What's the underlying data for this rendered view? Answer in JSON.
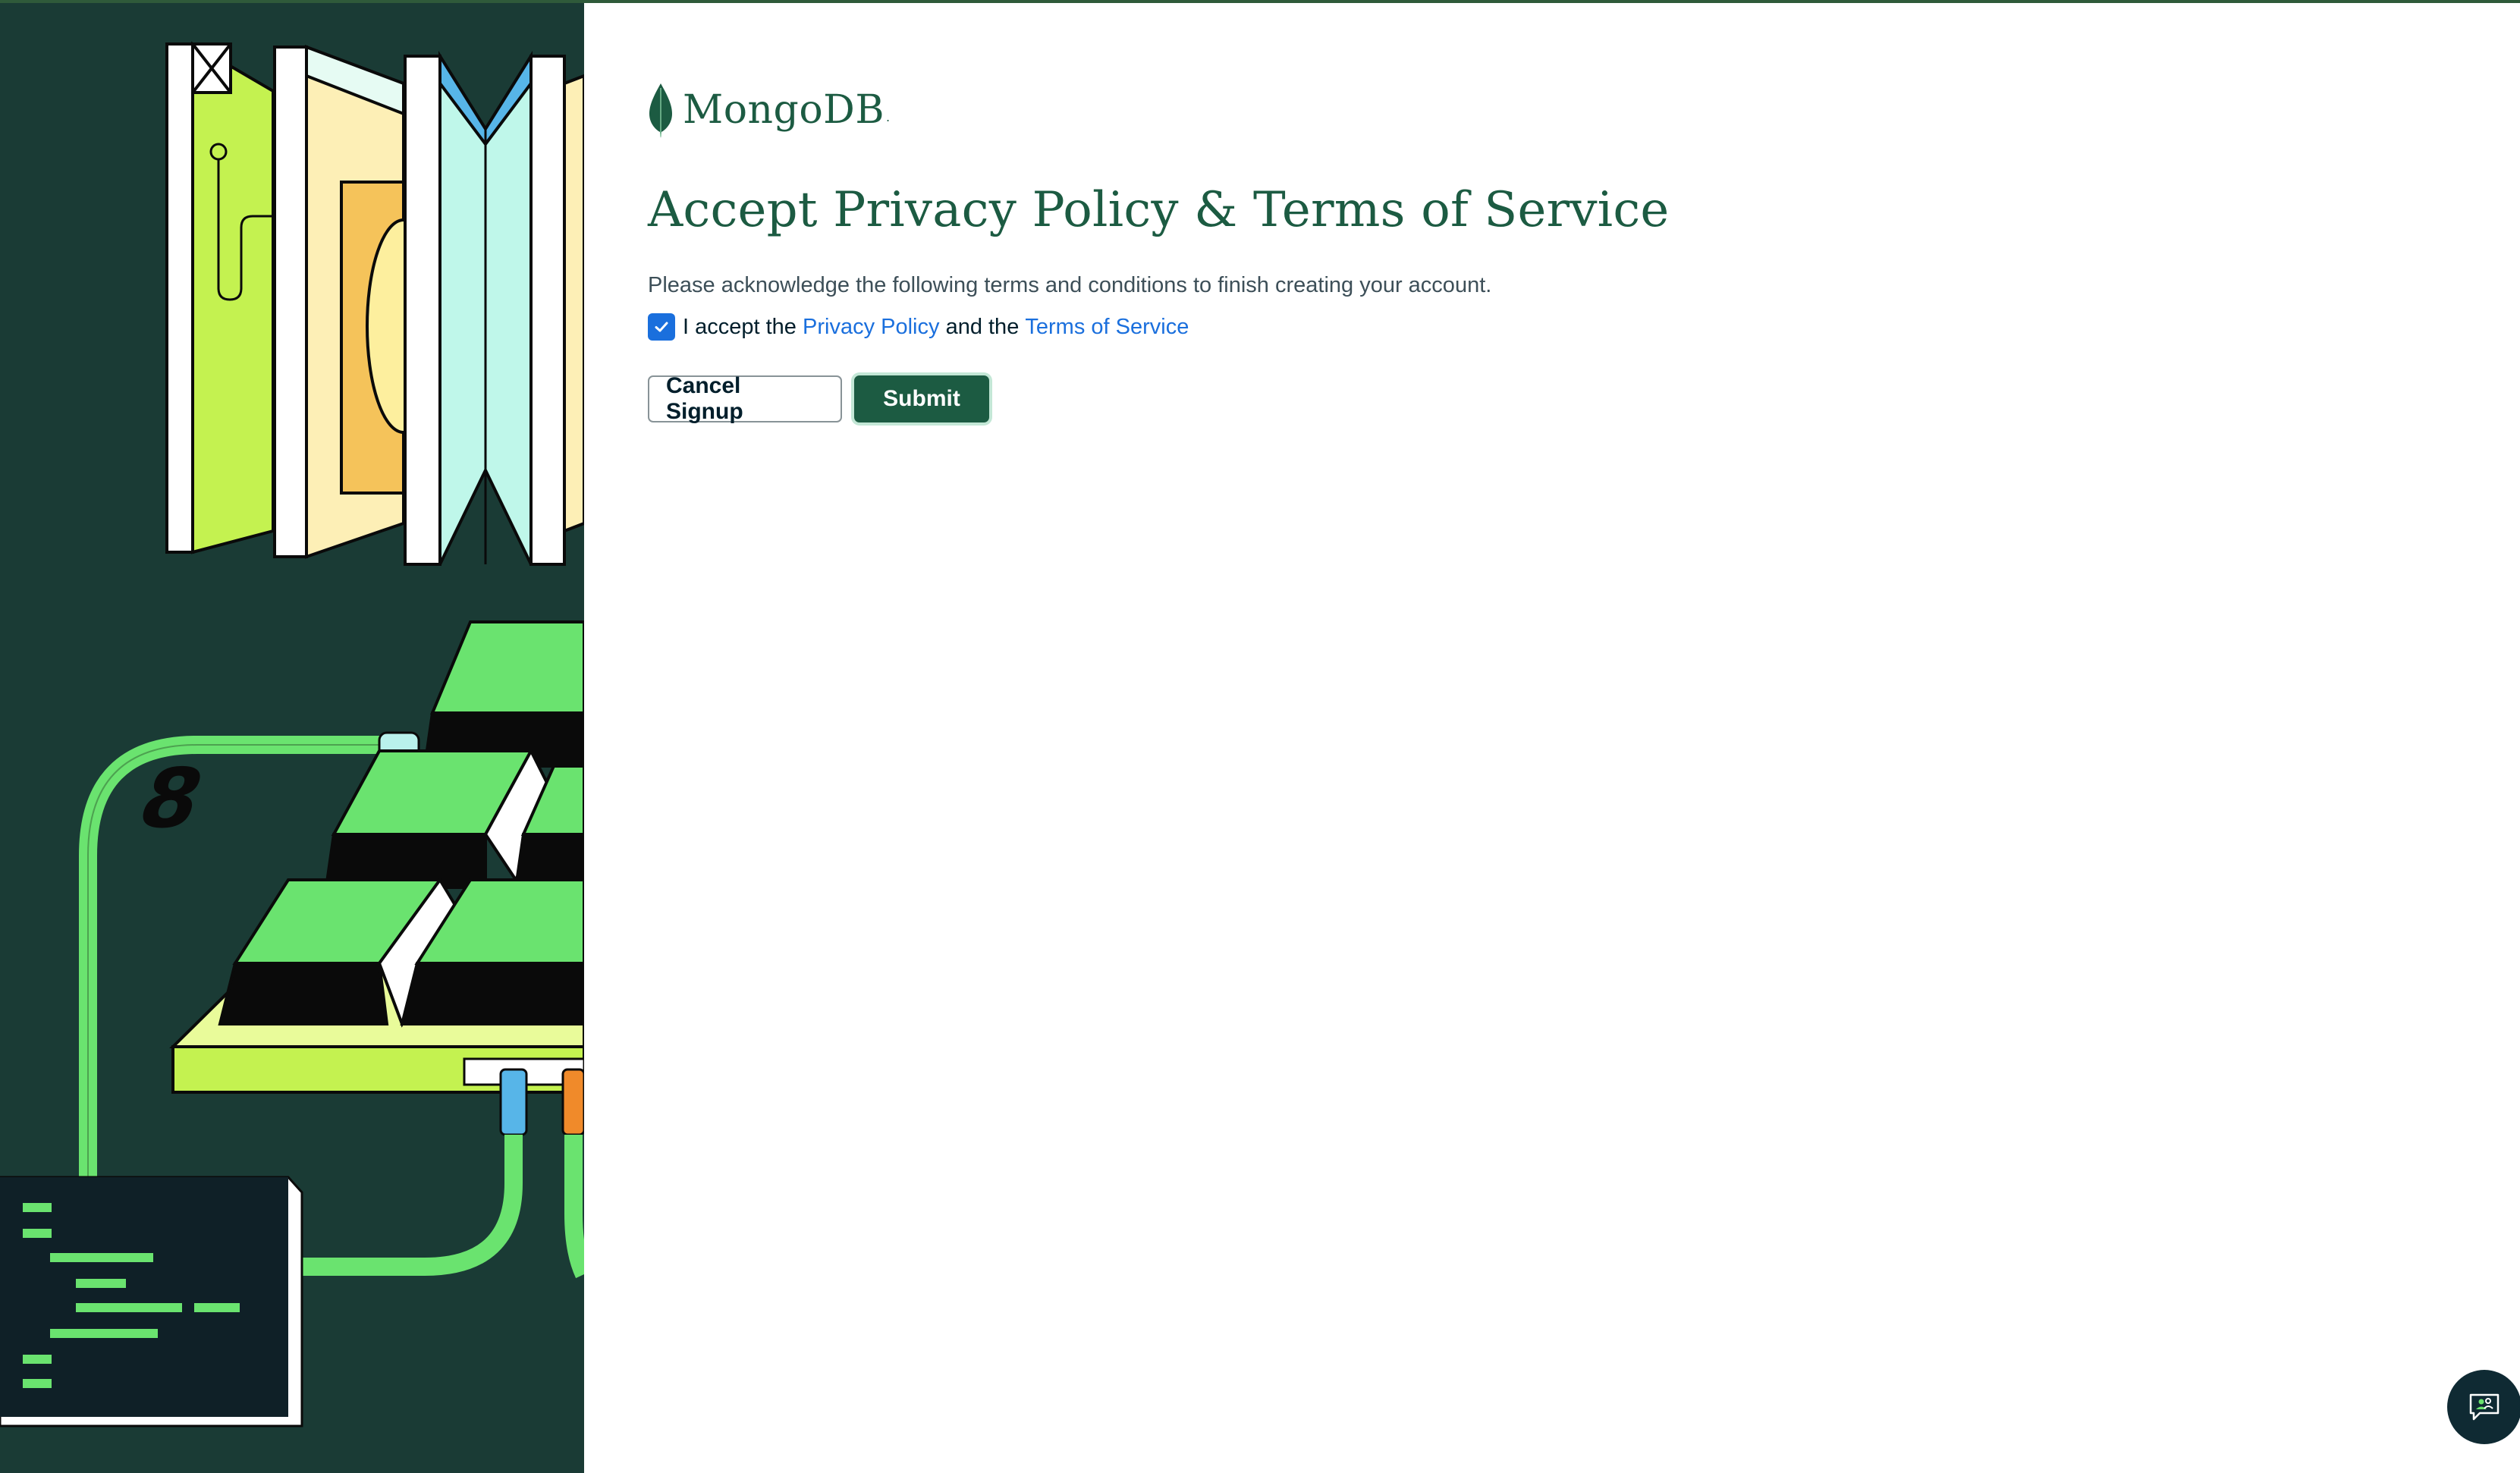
{
  "brand": {
    "name": "MongoDB",
    "registered_mark": ".",
    "color": "#1c5b42"
  },
  "page": {
    "title": "Accept Privacy Policy & Terms of Service",
    "description": "Please acknowledge the following terms and conditions to finish creating your account."
  },
  "consent": {
    "checked": true,
    "prefix": "I accept the",
    "privacy_link": "Privacy Policy",
    "connector": "and the",
    "terms_link": "Terms of Service",
    "link_color": "#1a6fdd"
  },
  "buttons": {
    "cancel": "Cancel Signup",
    "submit": "Submit"
  },
  "icons": {
    "logo": "mongodb-leaf-icon",
    "check": "checkmark-icon",
    "chat": "chat-support-icon"
  },
  "illustration": {
    "keycap_label": "8"
  },
  "colors": {
    "panel_bg": "#1a3b35",
    "accent_green": "#6ae36f",
    "lime": "#c4f250"
  }
}
